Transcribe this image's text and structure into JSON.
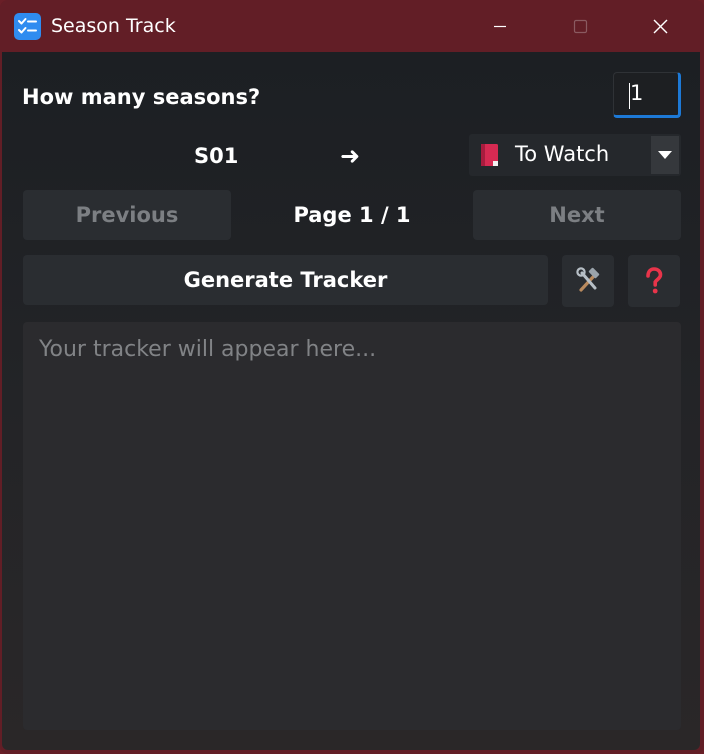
{
  "window": {
    "title": "Season Track",
    "icon": "checklist-icon"
  },
  "controls": {
    "minimize": "minimize-icon",
    "maximize": "maximize-icon",
    "close": "close-icon"
  },
  "seasons": {
    "label": "How many seasons?",
    "value": "1"
  },
  "season_row": {
    "code": "S01",
    "arrow": "➜",
    "status": {
      "selected": "To Watch",
      "icon": "red-book-icon"
    }
  },
  "pagination": {
    "previous_label": "Previous",
    "page_label": "Page 1 / 1",
    "next_label": "Next"
  },
  "actions": {
    "generate_label": "Generate Tracker",
    "tools_icon": "tools-icon",
    "help_icon": "question-mark-icon"
  },
  "tracker": {
    "placeholder": "Your tracker will appear here..."
  },
  "colors": {
    "titlebar": "#621e26",
    "accent": "#2f8cf0",
    "input_focus": "#1d79d6",
    "button_bg": "#2a2d31",
    "disabled_text": "#7c7f83",
    "help_red": "#e8344a"
  }
}
